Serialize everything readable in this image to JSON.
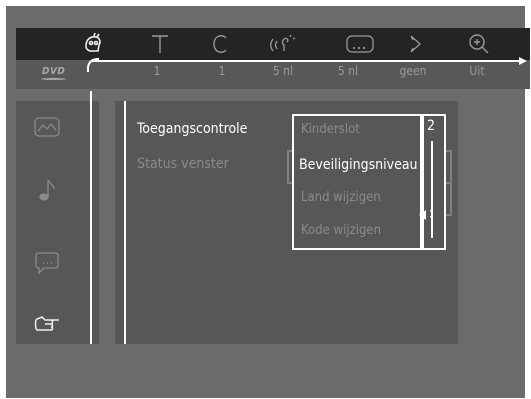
{
  "header": {
    "logo": "DVD",
    "icons": [
      {
        "name": "access-control-icon",
        "active": true
      },
      {
        "name": "title-icon",
        "active": false
      },
      {
        "name": "chapter-icon",
        "active": false
      },
      {
        "name": "audio-icon",
        "active": false
      },
      {
        "name": "subtitle-icon",
        "active": false
      },
      {
        "name": "angle-icon",
        "active": false
      },
      {
        "name": "zoom-icon",
        "active": false
      }
    ],
    "values": [
      "1",
      "1",
      "5 nl",
      "5 nl",
      "geen",
      "Uit"
    ]
  },
  "sidebar": {
    "icons": [
      "picture-icon",
      "music-note-icon",
      "speech-bubble-icon",
      "hand-pointer-icon"
    ]
  },
  "menu": {
    "items": [
      "Toegangscontrole",
      "Status venster"
    ],
    "selected": "Toegangscontrole"
  },
  "submenu": {
    "items": [
      "Kinderslot",
      "Beveiligingsniveau",
      "Land wijzigen",
      "Kode wijzigen"
    ],
    "selected": "Beveiligingsniveau",
    "level_value": "2"
  },
  "colors": {
    "screen_bg": "#6b6b6b",
    "panel_bg": "#575757",
    "topbar_bg": "#242424",
    "highlight": "#ffffff",
    "dim_text": "#8a8a8a"
  }
}
